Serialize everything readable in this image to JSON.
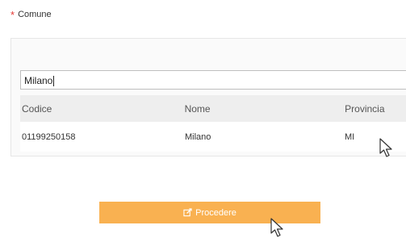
{
  "form": {
    "required_marker": "*",
    "field_label": "Comune"
  },
  "search": {
    "value": "Milano"
  },
  "table": {
    "headers": [
      "Codice",
      "Nome",
      "Provincia"
    ],
    "rows": [
      [
        "01199250158",
        "Milano",
        "MI"
      ]
    ]
  },
  "actions": {
    "proceed_label": "Procedere",
    "proceed_icon": "edit-icon"
  },
  "colors": {
    "required": "#e53935",
    "button": "#f9b151"
  }
}
